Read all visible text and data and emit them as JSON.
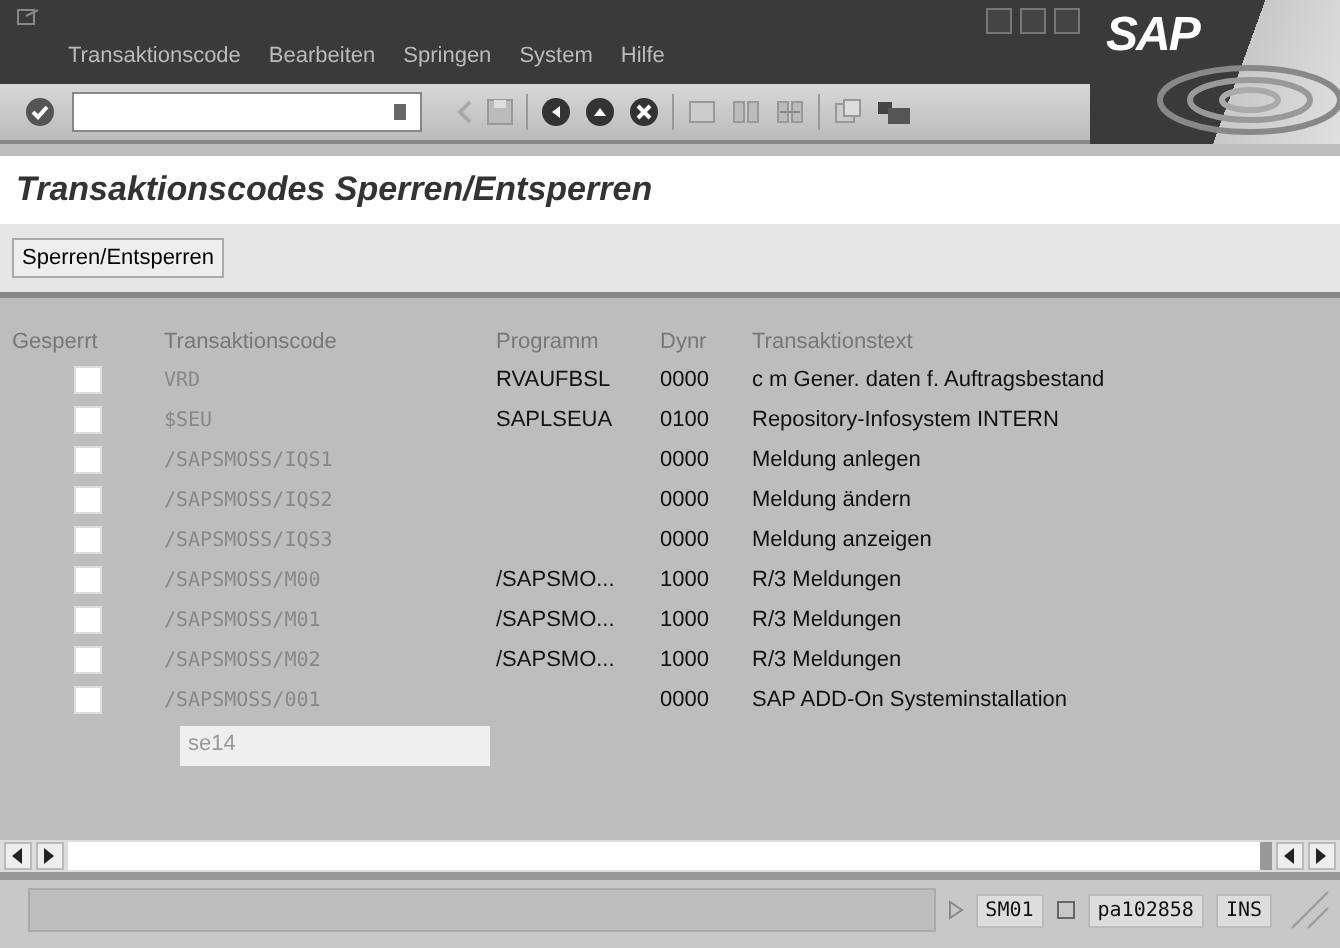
{
  "menu": [
    {
      "label": "Transaktionscode"
    },
    {
      "label": "Bearbeiten"
    },
    {
      "label": "Springen"
    },
    {
      "label": "System"
    },
    {
      "label": "Hilfe"
    }
  ],
  "logo": "SAP",
  "page_title": "Transaktionscodes Sperren/Entsperren",
  "app_button": "Sperren/Entsperren",
  "table": {
    "columns": [
      "Gesperrt",
      "Transaktionscode",
      "Programm",
      "Dynr",
      "Transaktionstext"
    ],
    "rows": [
      {
        "checked": false,
        "code": "VRD",
        "program": "RVAUFBSL",
        "dynr": "0000",
        "text": "c m Gener. daten f. Auftragsbestand"
      },
      {
        "checked": false,
        "code": "$SEU",
        "program": "SAPLSEUA",
        "dynr": "0100",
        "text": "Repository-Infosystem INTERN"
      },
      {
        "checked": false,
        "code": "/SAPSMOSS/IQS1",
        "dynr": "0000",
        "text": "Meldung anlegen"
      },
      {
        "checked": false,
        "code": "/SAPSMOSS/IQS2",
        "dynr": "0000",
        "text": "Meldung ändern"
      },
      {
        "checked": false,
        "code": "/SAPSMOSS/IQS3",
        "dynr": "0000",
        "text": "Meldung anzeigen"
      },
      {
        "checked": false,
        "code": "/SAPSMOSS/M00",
        "program": "/SAPSMO...",
        "dynr": "1000",
        "text": "R/3 Meldungen"
      },
      {
        "checked": false,
        "code": "/SAPSMOSS/M01",
        "program": "/SAPSMO...",
        "dynr": "1000",
        "text": "R/3 Meldungen"
      },
      {
        "checked": false,
        "code": "/SAPSMOSS/M02",
        "program": "/SAPSMO...",
        "dynr": "1000",
        "text": "R/3 Meldungen"
      },
      {
        "checked": false,
        "code": "/SAPSMOSS/001",
        "dynr": "0000",
        "text": "SAP ADD-On Systeminstallation"
      }
    ]
  },
  "input_value": "se14",
  "status_bar": {
    "transaction": "SM01",
    "server": "pa102858",
    "mode": "INS"
  }
}
